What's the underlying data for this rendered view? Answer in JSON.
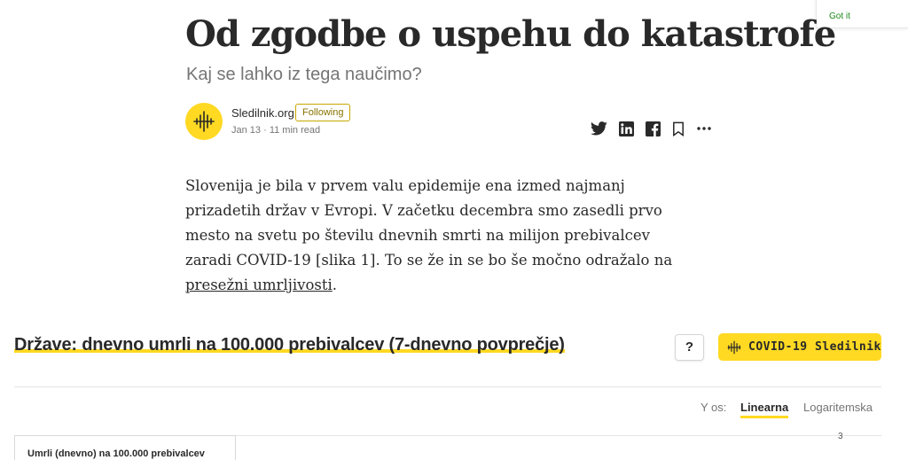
{
  "toast": {
    "action": "Got it"
  },
  "article": {
    "title": "Od zgodbe o uspehu do katastrofe",
    "subtitle": "Kaj se lahko iz tega naučimo?",
    "author": "Sledilnik.org",
    "follow_label": "Following",
    "date": "Jan 13",
    "read_time": "11 min read",
    "body_before_link": "Slovenija je bila v prvem valu epidemije ena izmed najmanj prizadetih držav v Evropi. V začetku decembra smo zasedli prvo mesto na svetu po številu dnevnih smrti na milijon prebivalcev zaradi COVID-19 [slika 1]. To se že in se bo še močno odražalo na ",
    "body_link": "presežni umrljivosti",
    "body_after_link": "."
  },
  "embed": {
    "title": "Države: dnevno umrli na 100.000 prebivalcev (7-dnevno povprečje)",
    "help_label": "?",
    "brand_label": "COVID-19 Sledilnik",
    "y_axis_label": "Y os:",
    "scale_linear": "Linearna",
    "scale_log": "Logaritemska",
    "chart_label": "Umrli (dnevno) na 100.000 prebivalcev",
    "y_tick": "3"
  },
  "colors": {
    "brand_yellow": "#ffd922",
    "follow_green": "#1a8917"
  }
}
